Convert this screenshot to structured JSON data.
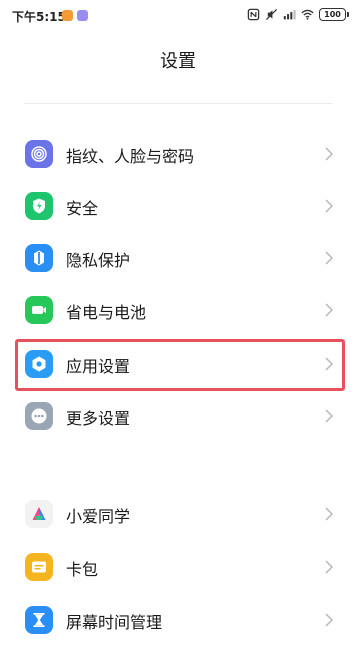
{
  "status_bar": {
    "time": "下午5:15",
    "battery": "100"
  },
  "header": {
    "title": "设置"
  },
  "items": [
    {
      "label": "指纹、人脸与密码",
      "icon": "fingerprint-icon",
      "color": "#6b73e8"
    },
    {
      "label": "安全",
      "icon": "shield-icon",
      "color": "#1fc46e"
    },
    {
      "label": "隐私保护",
      "icon": "privacy-icon",
      "color": "#2a8ff5"
    },
    {
      "label": "省电与电池",
      "icon": "battery-icon",
      "color": "#27c75a"
    },
    {
      "label": "应用设置",
      "icon": "gear-icon",
      "color": "#2a9cf5",
      "highlighted": true
    },
    {
      "label": "更多设置",
      "icon": "more-icon",
      "color": "#9aa6b4"
    },
    {
      "label": "小爱同学",
      "icon": "xiaoai-icon",
      "color": "#f2f2f2"
    },
    {
      "label": "卡包",
      "icon": "card-icon",
      "color": "#f5b520"
    },
    {
      "label": "屏幕时间管理",
      "icon": "hourglass-icon",
      "color": "#2a8ff5"
    }
  ],
  "highlight_color": "#e8505b"
}
